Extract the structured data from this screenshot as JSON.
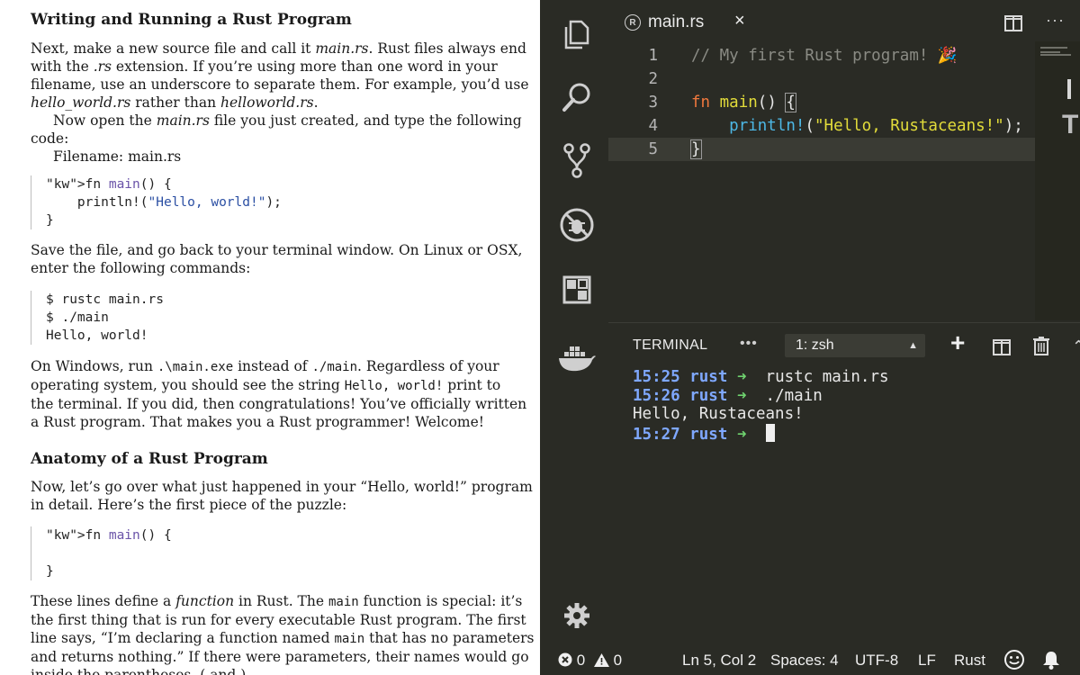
{
  "doc": {
    "heading1": "Writing and Running a Rust Program",
    "p1_lines": [
      [
        "Next, make a new source file and call it ",
        {
          "i": "main.rs"
        },
        ". Rust files always end"
      ],
      [
        "with the ",
        {
          "i": ".rs"
        },
        " extension.  If you’re using more than one word in your"
      ],
      [
        "filename, use an underscore to separate them. For example, you’d use"
      ],
      [
        {
          "i": "hello_world.rs"
        },
        " rather than ",
        {
          "i": "helloworld.rs"
        },
        "."
      ]
    ],
    "p2_lines": [
      [
        "Now open the ",
        {
          "i": "main.rs"
        },
        " file you just created, and type the following"
      ],
      [
        "code:"
      ]
    ],
    "filename_label": "Filename: main.rs",
    "code1": [
      "fn main() {",
      "    println!(\"Hello, world!\");",
      "}"
    ],
    "p3_lines": [
      [
        "Save the file, and go back to your terminal window. On Linux or OSX,"
      ],
      [
        "enter the following commands:"
      ]
    ],
    "code2": [
      "$ rustc main.rs",
      "$ ./main",
      "Hello, world!"
    ],
    "p4_lines": [
      [
        "On Windows, run ",
        {
          "m": ".\\main.exe"
        },
        " instead of ",
        {
          "m": "./main"
        },
        ". Regardless of your"
      ],
      [
        "operating system, you should see the string ",
        {
          "m": "Hello, world!"
        },
        " print to"
      ],
      [
        "the terminal. If you did, then congratulations! You’ve officially written"
      ],
      [
        "a Rust program. That makes you a Rust programmer! Welcome!"
      ]
    ],
    "heading2": "Anatomy of a Rust Program",
    "p5_lines": [
      [
        "Now, let’s go over what just happened in your “Hello, world!” program"
      ],
      [
        "in detail. Here’s the first piece of the puzzle:"
      ]
    ],
    "code3": [
      "fn main() {",
      "",
      "}"
    ],
    "p6_lines": [
      [
        "These lines define a ",
        {
          "i": "function"
        },
        " in Rust. The ",
        {
          "m": "main"
        },
        " function is special: it’s"
      ],
      [
        "the first thing that is run for every executable Rust program. The first"
      ],
      [
        "line says, “I’m declaring a function named ",
        {
          "m": "main"
        },
        " that has no parameters"
      ],
      [
        "and returns nothing.” If there were parameters, their names would go"
      ],
      [
        "inside the parentheses, ( and )."
      ]
    ]
  },
  "editor": {
    "tab_label": "main.rs",
    "tab_close": "×",
    "more": "···",
    "line_numbers": [
      "1",
      "2",
      "3",
      "4",
      "5"
    ],
    "code_lines": [
      [
        {
          "t": "// My first Rust program! 🎉",
          "c": "c-comment"
        }
      ],
      [],
      [
        {
          "t": "fn",
          "c": "c-kw"
        },
        {
          "t": " "
        },
        {
          "t": "main",
          "c": "c-fn"
        },
        {
          "t": "() ",
          "c": "c-punc"
        },
        {
          "t": "{",
          "c": "c-punc bracket"
        }
      ],
      [
        {
          "t": "    "
        },
        {
          "t": "println!",
          "c": "c-mac"
        },
        {
          "t": "(",
          "c": "c-punc"
        },
        {
          "t": "\"Hello, Rustaceans!\"",
          "c": "c-str"
        },
        {
          "t": ");",
          "c": "c-punc"
        }
      ],
      [
        {
          "t": "}",
          "c": "c-punc bracket"
        }
      ]
    ],
    "active_line": 5,
    "minimap_char": "T",
    "panel": {
      "title": "TERMINAL",
      "dots": "•••",
      "terminal_select": "1: zsh",
      "plus": "+",
      "chevron": "⌃"
    },
    "terminal_lines": [
      {
        "time": "15:25",
        "dir": "rust",
        "arrow": "➜",
        "cmd": "rustc main.rs"
      },
      {
        "time": "15:26",
        "dir": "rust",
        "arrow": "➜",
        "cmd": "./main"
      },
      {
        "output": "Hello, Rustaceans!"
      },
      {
        "time": "15:27",
        "dir": "rust",
        "arrow": "➜",
        "cmd": "",
        "cursor": true
      }
    ],
    "status": {
      "errors": "0",
      "warnings": "0",
      "position": "Ln 5, Col 2",
      "spaces": "Spaces: 4",
      "encoding": "UTF-8",
      "eol": "LF",
      "language": "Rust"
    },
    "icons": [
      "files-icon",
      "search-icon",
      "source-control-icon",
      "debug-icon",
      "extensions-icon",
      "docker-icon",
      "gear-icon"
    ]
  }
}
